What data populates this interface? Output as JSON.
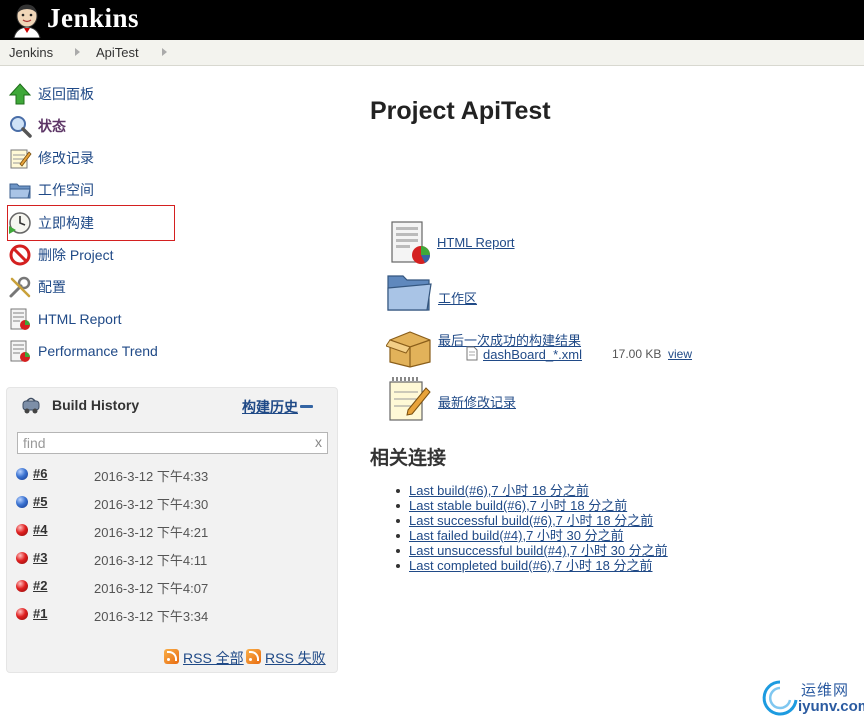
{
  "header": {
    "brand": "Jenkins"
  },
  "breadcrumbs": [
    "Jenkins",
    "ApiTest"
  ],
  "tasks": [
    {
      "label": "返回面板",
      "icon": "up-arrow-icon"
    },
    {
      "label": "状态",
      "icon": "magnifier-icon"
    },
    {
      "label": "修改记录",
      "icon": "notepad-icon"
    },
    {
      "label": "工作空间",
      "icon": "folder-icon"
    },
    {
      "label": "立即构建",
      "icon": "clock-icon"
    },
    {
      "label": "删除 Project",
      "icon": "no-entry-icon"
    },
    {
      "label": "配置",
      "icon": "tools-icon"
    },
    {
      "label": "HTML Report",
      "icon": "report-icon"
    },
    {
      "label": "Performance Trend",
      "icon": "report-icon"
    }
  ],
  "build_history": {
    "title": "Build History",
    "link": "构建历史",
    "search_placeholder": "find",
    "clear": "x",
    "builds": [
      {
        "number": "#6",
        "date": "2016-3-12 下午4:33",
        "status": "success"
      },
      {
        "number": "#5",
        "date": "2016-3-12 下午4:30",
        "status": "success"
      },
      {
        "number": "#4",
        "date": "2016-3-12 下午4:21",
        "status": "failed"
      },
      {
        "number": "#3",
        "date": "2016-3-12 下午4:11",
        "status": "failed"
      },
      {
        "number": "#2",
        "date": "2016-3-12 下午4:07",
        "status": "failed"
      },
      {
        "number": "#1",
        "date": "2016-3-12 下午3:34",
        "status": "failed"
      }
    ],
    "rss_all": "RSS 全部",
    "rss_failed": "RSS 失败"
  },
  "main": {
    "title": "Project ApiTest",
    "html_report": "HTML Report",
    "workspace": "工作区",
    "last_success": "最后一次成功的构建结果",
    "artifact": {
      "name": "dashBoard_*.xml",
      "size": "17.00 KB",
      "view": "view"
    },
    "recent_changes": "最新修改记录",
    "related_title": "相关连接",
    "related_links": [
      "Last build(#6),7 小时 18 分之前",
      "Last stable build(#6),7 小时 18 分之前",
      "Last successful build(#6),7 小时 18 分之前",
      "Last failed build(#4),7 小时 30 分之前",
      "Last unsuccessful build(#4),7 小时 30 分之前",
      "Last completed build(#6),7 小时 18 分之前"
    ]
  },
  "watermark": {
    "cn": "运维网",
    "en": "iyunv.com"
  },
  "colors": {
    "link": "#204a87",
    "visited": "#5c3566",
    "header": "#000000",
    "highlight": "#d42020"
  }
}
